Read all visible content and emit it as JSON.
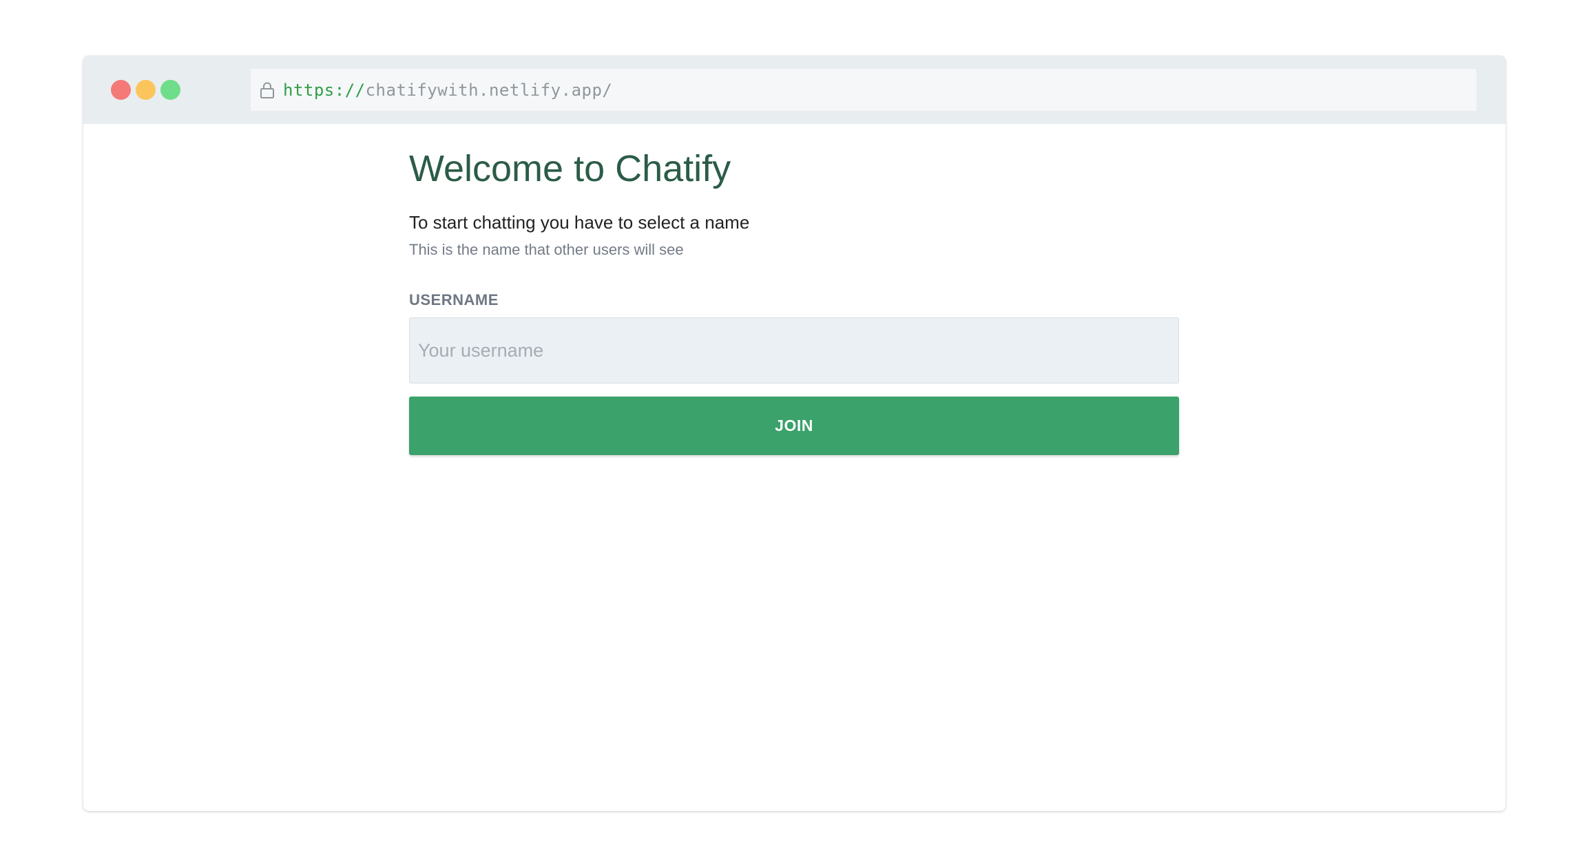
{
  "browser": {
    "url_scheme": "https://",
    "url_host": "chatifywith.netlify.app/",
    "traffic_lights": [
      "#f47a78",
      "#fbc55c",
      "#6fde8a"
    ]
  },
  "page": {
    "title": "Welcome to Chatify",
    "subtitle": "To start chatting you have to select a name",
    "hint": "This is the name that other users will see",
    "username_label": "USERNAME",
    "username_placeholder": "Your username",
    "username_value": "",
    "join_label": "JOIN"
  },
  "colors": {
    "title": "#2b5c47",
    "button": "#3aa26a",
    "url_scheme": "#2e9e47"
  },
  "icons": {
    "lock": "lock-icon"
  }
}
